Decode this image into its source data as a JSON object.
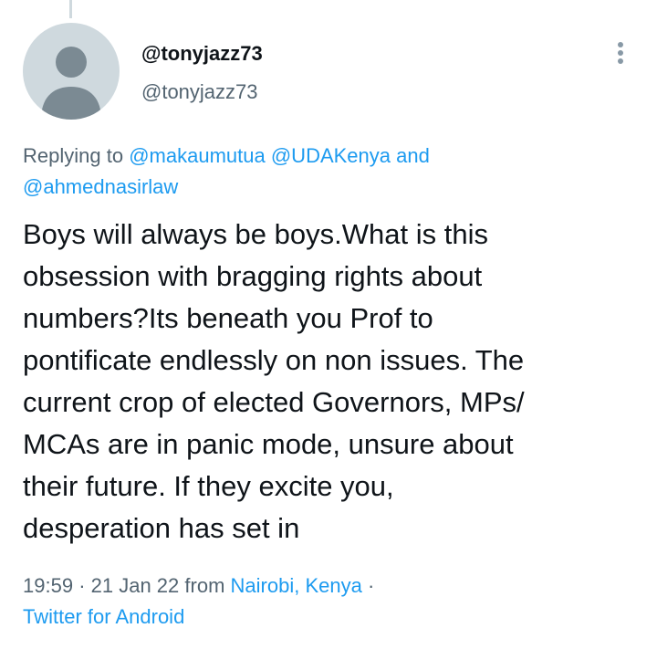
{
  "user": {
    "display_name": "@tonyjazz73",
    "handle": "@tonyjazz73",
    "avatar_icon": "default-avatar-icon"
  },
  "menu": {
    "more_icon": "vertical-ellipsis-icon"
  },
  "replying": {
    "prefix": "Replying to",
    "mention_1": "@makaumutua",
    "mention_2": "@UDAKenya",
    "conjunction": "and",
    "mention_3": "@ahmednasirlaw"
  },
  "tweet": {
    "text": "Boys will always be boys.What is this\nobsession with bragging rights about\nnumbers?Its beneath you Prof to\npontificate endlessly on non issues. The\ncurrent crop of elected Governors, MPs/\nMCAs are in panic mode, unsure about\ntheir future. If they excite you,\ndesperation has set in"
  },
  "meta": {
    "time": "19:59",
    "separator_1": "·",
    "date": "21 Jan 22",
    "from_label": "from",
    "location": "Nairobi, Kenya",
    "separator_2": "·",
    "source": "Twitter for Android"
  },
  "colors": {
    "accent": "#1d9bf0",
    "text_primary": "#0f1419",
    "text_secondary": "#536471",
    "avatar_bg": "#cfd9de",
    "avatar_fg": "#7b8a93"
  }
}
